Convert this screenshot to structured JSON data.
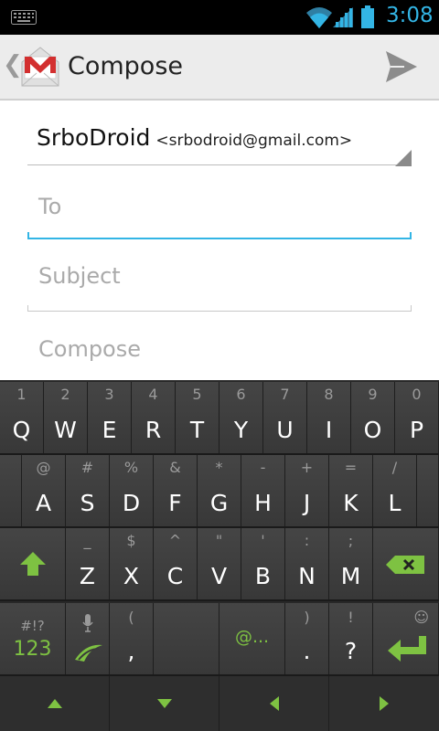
{
  "status_bar": {
    "time": "3:08",
    "time_color": "#33b5e5"
  },
  "action_bar": {
    "title": "Compose",
    "up_glyph": "❮",
    "app_icon": "gmail-icon",
    "send_icon": "send-icon"
  },
  "form": {
    "from_name": "SrboDroid",
    "from_email": "<srbodroid@gmail.com>",
    "to_placeholder": "To",
    "subject_placeholder": "Subject",
    "compose_placeholder": "Compose"
  },
  "accent_color": "#33b5e5",
  "keyboard_accent_color": "#7ec242",
  "keyboard": {
    "row1": [
      {
        "main": "Q",
        "hint": "1"
      },
      {
        "main": "W",
        "hint": "2"
      },
      {
        "main": "E",
        "hint": "3"
      },
      {
        "main": "R",
        "hint": "4"
      },
      {
        "main": "T",
        "hint": "5"
      },
      {
        "main": "Y",
        "hint": "6"
      },
      {
        "main": "U",
        "hint": "7"
      },
      {
        "main": "I",
        "hint": "8"
      },
      {
        "main": "O",
        "hint": "9"
      },
      {
        "main": "P",
        "hint": "0"
      }
    ],
    "row2": [
      {
        "main": "A",
        "hint": "@"
      },
      {
        "main": "S",
        "hint": "#"
      },
      {
        "main": "D",
        "hint": "%"
      },
      {
        "main": "F",
        "hint": "&"
      },
      {
        "main": "G",
        "hint": "*"
      },
      {
        "main": "H",
        "hint": "-"
      },
      {
        "main": "J",
        "hint": "+"
      },
      {
        "main": "K",
        "hint": "="
      },
      {
        "main": "L",
        "hint": "/"
      }
    ],
    "row3": [
      {
        "main": "Z",
        "hint": "_"
      },
      {
        "main": "X",
        "hint": "$"
      },
      {
        "main": "C",
        "hint": "^"
      },
      {
        "main": "V",
        "hint": "\""
      },
      {
        "main": "B",
        "hint": "'"
      },
      {
        "main": "N",
        "hint": ":"
      },
      {
        "main": "M",
        "hint": ";"
      }
    ],
    "row4": {
      "sym_hint": "#!?",
      "sym_label": "123",
      "comma_hint": "(",
      "comma_label": ",",
      "at_label": "@...",
      "period_hint": ")",
      "period_label": ".",
      "question_hint": "!",
      "question_label": "?",
      "enter_hint": "☺"
    }
  }
}
